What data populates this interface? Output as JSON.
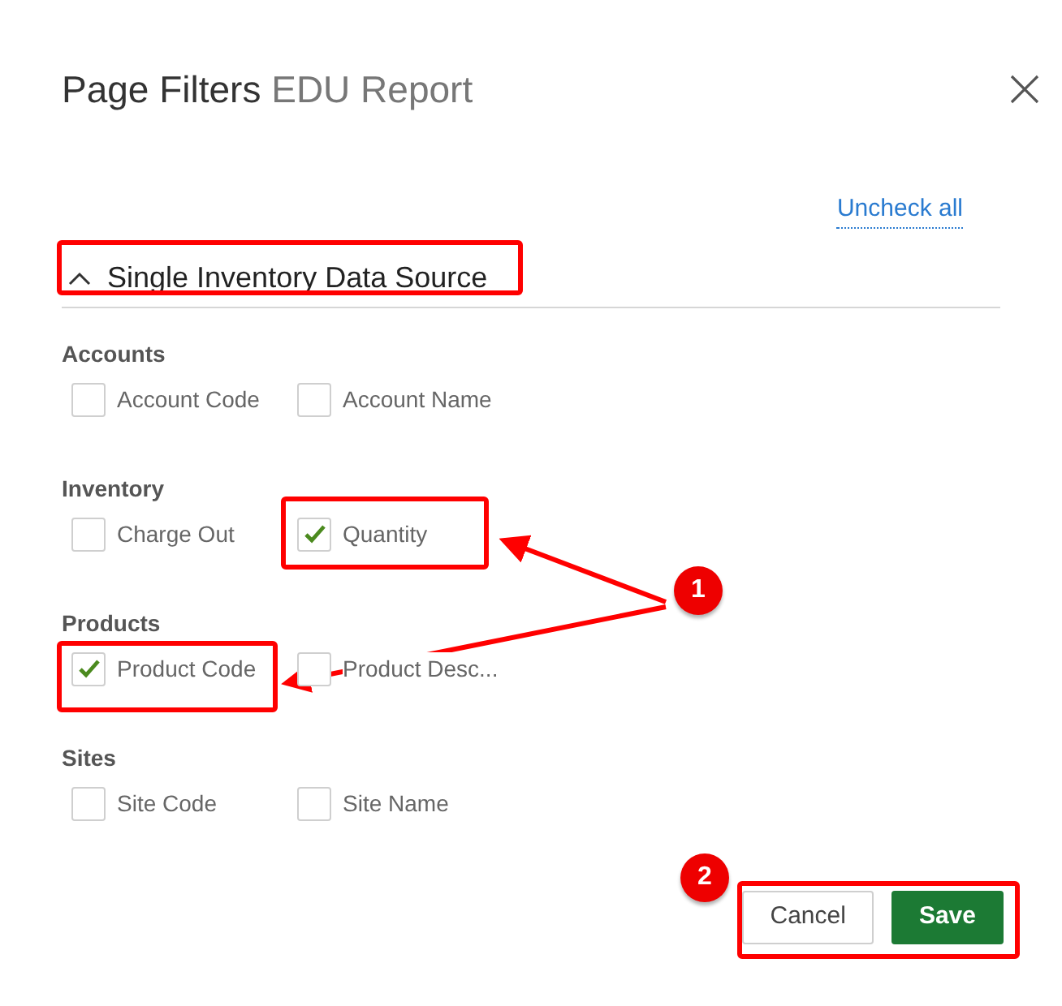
{
  "dialog": {
    "title": "Page Filters",
    "subtitle": "EDU Report"
  },
  "uncheck_all": "Uncheck all",
  "section": {
    "title": "Single Inventory Data Source",
    "expanded": true
  },
  "groups": [
    {
      "title": "Accounts",
      "items": [
        {
          "label": "Account Code",
          "checked": false
        },
        {
          "label": "Account Name",
          "checked": false
        }
      ]
    },
    {
      "title": "Inventory",
      "items": [
        {
          "label": "Charge Out",
          "checked": false
        },
        {
          "label": "Quantity",
          "checked": true
        }
      ]
    },
    {
      "title": "Products",
      "items": [
        {
          "label": "Product Code",
          "checked": true
        },
        {
          "label": "Product Desc...",
          "checked": false
        }
      ]
    },
    {
      "title": "Sites",
      "items": [
        {
          "label": "Site Code",
          "checked": false
        },
        {
          "label": "Site Name",
          "checked": false
        }
      ]
    }
  ],
  "buttons": [
    {
      "label": "Cancel",
      "kind": "secondary"
    },
    {
      "label": "Save",
      "kind": "primary"
    }
  ],
  "annotations": {
    "badges": [
      "1",
      "2"
    ]
  }
}
